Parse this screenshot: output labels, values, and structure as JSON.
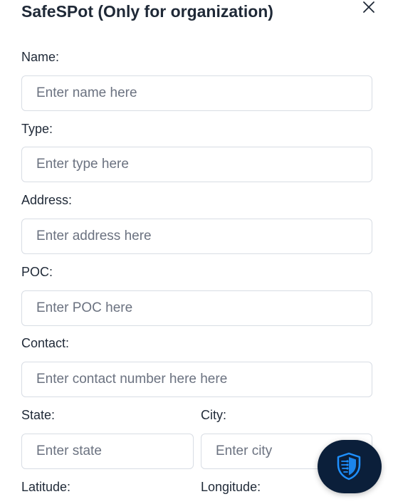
{
  "dialog": {
    "title": "SafeSPot (Only for organization)"
  },
  "form": {
    "name": {
      "label": "Name:",
      "placeholder": "Enter name here"
    },
    "type": {
      "label": "Type:",
      "placeholder": "Enter type here"
    },
    "address": {
      "label": "Address:",
      "placeholder": "Enter address here"
    },
    "poc": {
      "label": "POC:",
      "placeholder": "Enter POC here"
    },
    "contact": {
      "label": "Contact:",
      "placeholder": "Enter contact number here here"
    },
    "state": {
      "label": "State:",
      "placeholder": "Enter state"
    },
    "city": {
      "label": "City:",
      "placeholder": "Enter city"
    },
    "latitude": {
      "label": "Latitude:"
    },
    "longitude": {
      "label": "Longitude:"
    }
  },
  "icons": {
    "close": "close-icon",
    "fab": "shield-icon"
  },
  "colors": {
    "text": "#1f2937",
    "placeholder": "#6b7280",
    "border": "#d8dde4",
    "fab_background": "#0b1f3a",
    "fab_accent": "#1e90ff"
  }
}
